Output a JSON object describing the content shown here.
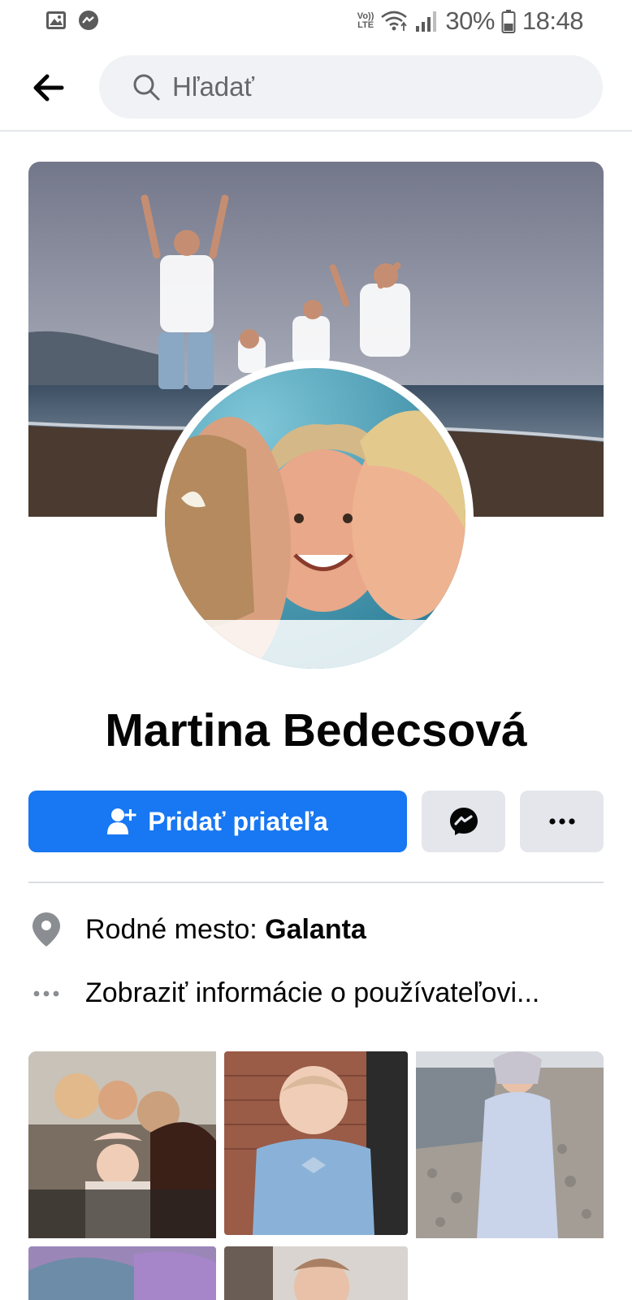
{
  "status_bar": {
    "volte_top": "Vo))",
    "volte_bottom": "LTE",
    "battery": "30%",
    "time": "18:48",
    "left_icons": [
      "gallery-icon",
      "messenger-icon"
    ],
    "right_icons": [
      "wifi-icon",
      "signal-icon",
      "battery-icon"
    ]
  },
  "search": {
    "placeholder": "Hľadať"
  },
  "profile": {
    "name": "Martina Bedecsová"
  },
  "actions": {
    "add_friend_label": "Pridať priateľa"
  },
  "info": {
    "hometown_label": "Rodné mesto: ",
    "hometown_value": "Galanta",
    "more_about": "Zobraziť informácie o používateľovi..."
  },
  "colors": {
    "primary": "#1877f2",
    "secondary_button": "#e4e6eb",
    "search_bg": "#f0f2f5",
    "text": "#050505",
    "muted": "#65676b"
  }
}
